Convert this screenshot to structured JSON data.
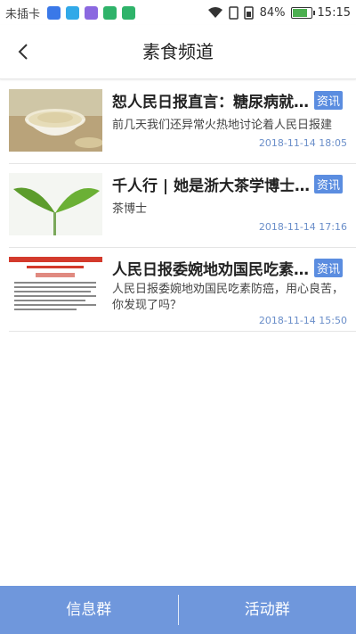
{
  "status": {
    "carrier": "未插卡",
    "battery": "84%",
    "battery_level": 0.84,
    "time": "15:15",
    "colors": [
      "#3a78e8",
      "#31a9e8",
      "#8b68e0",
      "#2fb36a",
      "#2fb36a"
    ]
  },
  "header": {
    "title": "素食频道"
  },
  "articles": [
    {
      "title": "恕人民日报直言：糖尿病就…",
      "tag": "资讯",
      "desc": "前几天我们还异常火热地讨论着人民日报建",
      "date": "2018-11-14 18:05"
    },
    {
      "title": "千人行 | 她是浙大茶学博士…",
      "tag": "资讯",
      "desc": "茶博士",
      "date": "2018-11-14 17:16"
    },
    {
      "title": "人民日报委婉地劝国民吃素…",
      "tag": "资讯",
      "desc": "人民日报委婉地劝国民吃素防癌，用心良苦，你发现了吗？",
      "date": "2018-11-14 15:50"
    }
  ],
  "tabs": [
    "信息群",
    "活动群"
  ]
}
